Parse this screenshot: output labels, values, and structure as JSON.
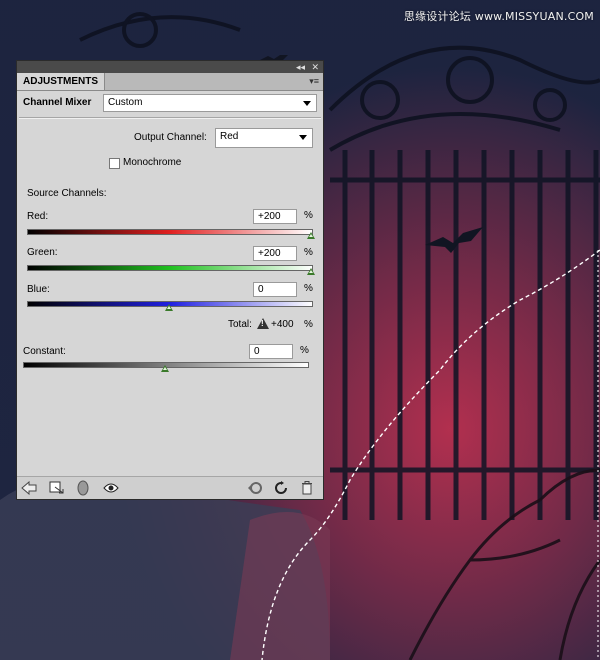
{
  "watermark": "思缘设计论坛 www.MISSYUAN.COM",
  "panel": {
    "tab_label": "ADJUSTMENTS",
    "header_label": "Channel Mixer",
    "preset_value": "Custom",
    "output_channel_label": "Output Channel:",
    "output_channel_value": "Red",
    "monochrome_label": "Monochrome",
    "monochrome_checked": false,
    "source_channels_label": "Source Channels:",
    "channels": [
      {
        "label": "Red:",
        "value": "+200",
        "percent": 200,
        "unit": "%",
        "color": "#e02020"
      },
      {
        "label": "Green:",
        "value": "+200",
        "percent": 200,
        "unit": "%",
        "color": "#20c020"
      },
      {
        "label": "Blue:",
        "value": "0",
        "percent": 0,
        "unit": "%",
        "color": "#2020e0"
      }
    ],
    "total_label": "Total:",
    "total_value": "+400",
    "total_unit": "%",
    "constant_label": "Constant:",
    "constant_value": "0",
    "constant_percent": 0,
    "constant_unit": "%"
  },
  "footer_icons": [
    "back-arrow-icon",
    "clip-to-layer-icon",
    "layer-visibility-mask-icon",
    "eye-icon",
    "view-previous-icon",
    "reset-icon",
    "trash-icon"
  ]
}
